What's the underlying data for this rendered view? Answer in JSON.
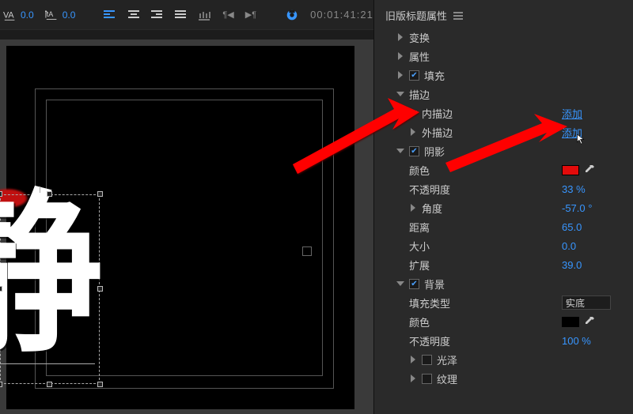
{
  "toolbar": {
    "va": "0.0",
    "ta": "0.0",
    "timecode": "00:01:41:21"
  },
  "canvas": {
    "glyph": "静"
  },
  "panel": {
    "title": "旧版标题属性",
    "transform": "变换",
    "attributes": "属性",
    "fill": "填充",
    "stroke": "描边",
    "inner_stroke": "内描边",
    "outer_stroke": "外描边",
    "add": "添加",
    "shadow": "阴影",
    "color": "颜色",
    "opacity": "不透明度",
    "opacity_val": "33 %",
    "angle": "角度",
    "angle_val": "-57.0 °",
    "distance": "距离",
    "distance_val": "65.0",
    "size": "大小",
    "size_val": "0.0",
    "spread": "扩展",
    "spread_val": "39.0",
    "background": "背景",
    "fill_type": "填充类型",
    "fill_type_val": "实底",
    "bg_opacity_val": "100 %",
    "sheen": "光泽",
    "texture": "纹理",
    "colors": {
      "shadow_color": "#e20b0b",
      "bg_color": "#000000"
    }
  }
}
